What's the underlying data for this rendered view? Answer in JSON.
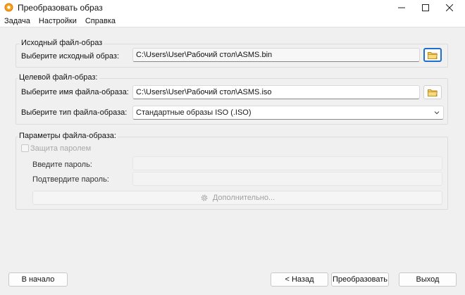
{
  "window": {
    "title": "Преобразовать образ"
  },
  "menu": [
    "Задача",
    "Настройки",
    "Справка"
  ],
  "source_group": {
    "title": "Исходный файл-образ",
    "label": "Выберите исходный образ:",
    "value": "C:\\Users\\User\\Рабочий стол\\ASMS.bin"
  },
  "target_group": {
    "title": "Целевой файл-образ:",
    "name_label": "Выберите имя файла-образа:",
    "name_value": "C:\\Users\\User\\Рабочий стол\\ASMS.iso",
    "type_label": "Выберите тип файла-образа:",
    "type_value": "Стандартные образы ISO (.ISO)"
  },
  "params_group": {
    "title": "Параметры файла-образа:",
    "password_checkbox": "Защита паролем",
    "password_label": "Введите пароль:",
    "confirm_label": "Подтвердите пароль:",
    "advanced_button": "Дополнительно..."
  },
  "buttons": {
    "home": "В начало",
    "back": "< Назад",
    "convert": "Преобразовать",
    "exit": "Выход"
  },
  "colors": {
    "accent": "#1f6fd1",
    "folder": "#e8b94a"
  }
}
